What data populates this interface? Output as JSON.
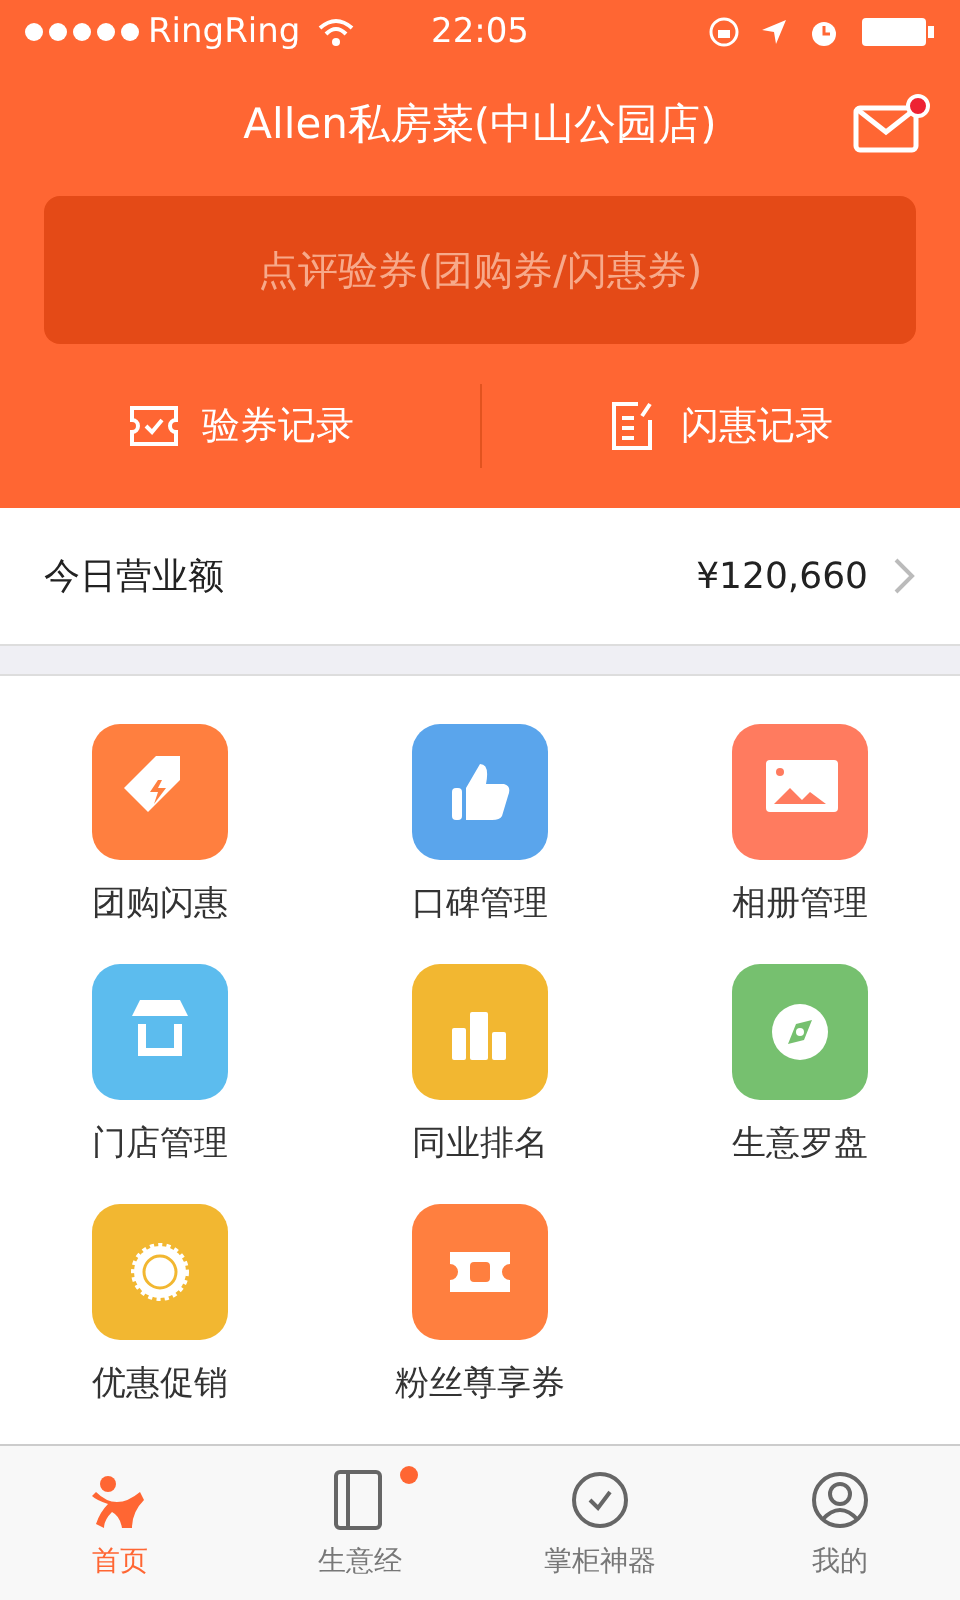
{
  "status_bar": {
    "carrier": "RingRing",
    "time": "22:05"
  },
  "header": {
    "title": "Allen私房菜(中山公园店)",
    "mail_unread": true,
    "verify_button": "点评验券(团购券/闪惠券)",
    "records": [
      "验券记录",
      "闪惠记录"
    ]
  },
  "revenue": {
    "label": "今日营业额",
    "value": "¥120,660"
  },
  "grid": [
    {
      "label": "团购闪惠",
      "color": "#ff7f3f"
    },
    {
      "label": "口碑管理",
      "color": "#5aa5ec"
    },
    {
      "label": "相册管理",
      "color": "#ff7b5f"
    },
    {
      "label": "门店管理",
      "color": "#5cbcee"
    },
    {
      "label": "同业排名",
      "color": "#f2b731"
    },
    {
      "label": "生意罗盘",
      "color": "#76c06f"
    },
    {
      "label": "优惠促销",
      "color": "#f2b731"
    },
    {
      "label": "粉丝尊享券",
      "color": "#ff7f3f"
    }
  ],
  "tabs": [
    {
      "label": "首页",
      "selected": true,
      "badge": false
    },
    {
      "label": "生意经",
      "selected": false,
      "badge": true
    },
    {
      "label": "掌柜神器",
      "selected": false,
      "badge": false
    },
    {
      "label": "我的",
      "selected": false,
      "badge": false
    }
  ]
}
